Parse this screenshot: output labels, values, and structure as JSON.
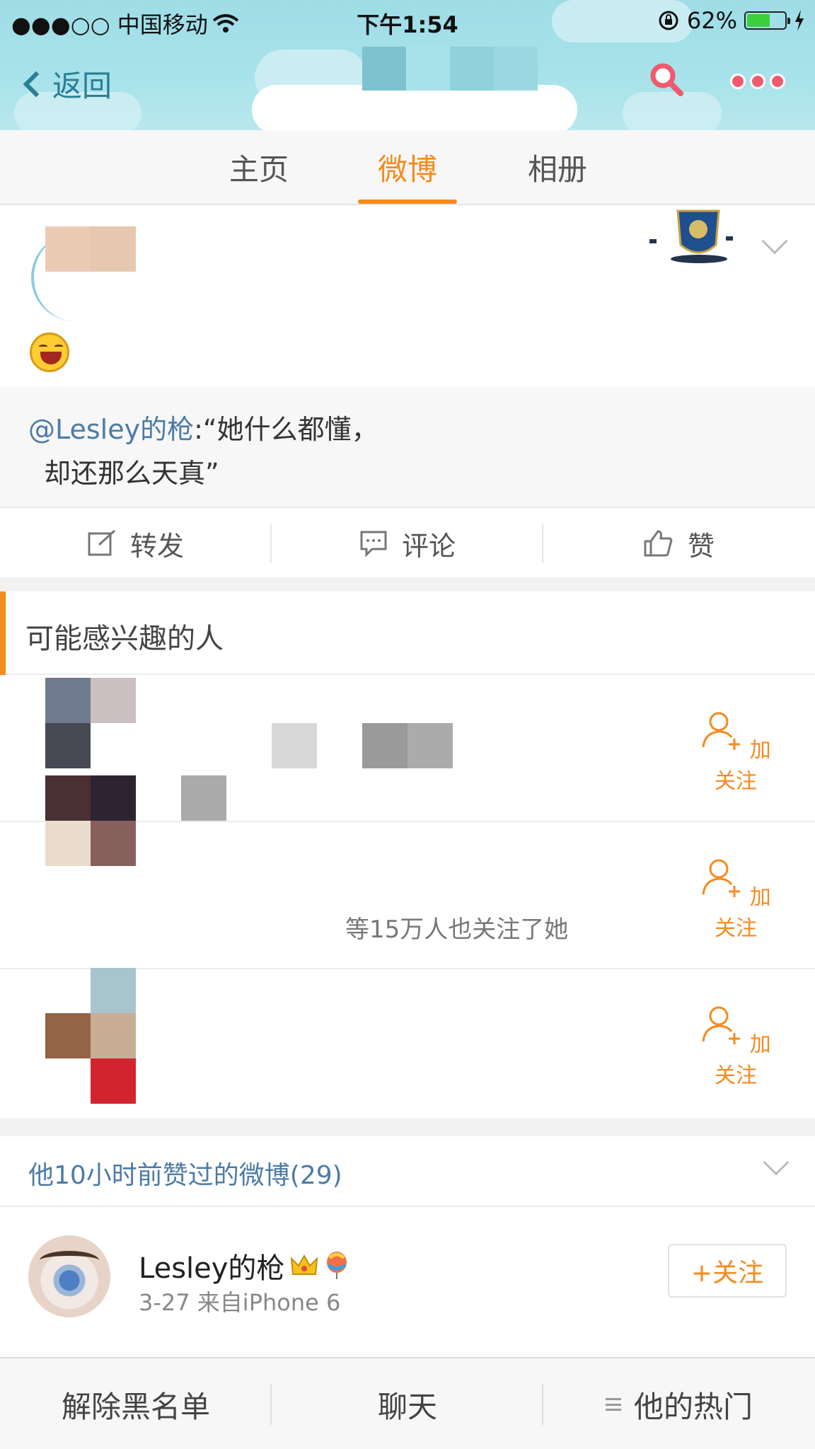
{
  "status_bar": {
    "carrier": "●●●○○ 中国移动",
    "time": "下午1:54",
    "battery_percent": "62%",
    "battery_level": 0.62
  },
  "nav": {
    "back_label": "返回",
    "search_icon": "search-icon",
    "more_icon": "more-icon"
  },
  "tabs": [
    {
      "label": "主页",
      "active": false
    },
    {
      "label": "微博",
      "active": true
    },
    {
      "label": "相册",
      "active": false
    }
  ],
  "post": {
    "repost_at": "@Lesley的枪",
    "repost_line1": ":“她什么都懂，",
    "repost_line2": "却还那么天真”",
    "actions": {
      "repost": "转发",
      "comment": "评论",
      "like": "赞"
    }
  },
  "suggestions": {
    "title": "可能感兴趣的人",
    "follow_label": "加关注",
    "rows": [
      {
        "reason": ""
      },
      {
        "reason": "等15万人也关注了她"
      },
      {
        "reason": ""
      }
    ]
  },
  "liked": {
    "header": "他10小时前赞过的微博(29)",
    "user_name": "Lesley的枪",
    "meta": "3-27  来自iPhone 6",
    "follow_button": "+关注"
  },
  "bottom_bar": {
    "unblock": "解除黑名单",
    "chat": "聊天",
    "hot": "他的热门"
  },
  "colors": {
    "accent": "#f58a1f",
    "link": "#4d7ba6",
    "header_bg": "#a8e2ea"
  }
}
